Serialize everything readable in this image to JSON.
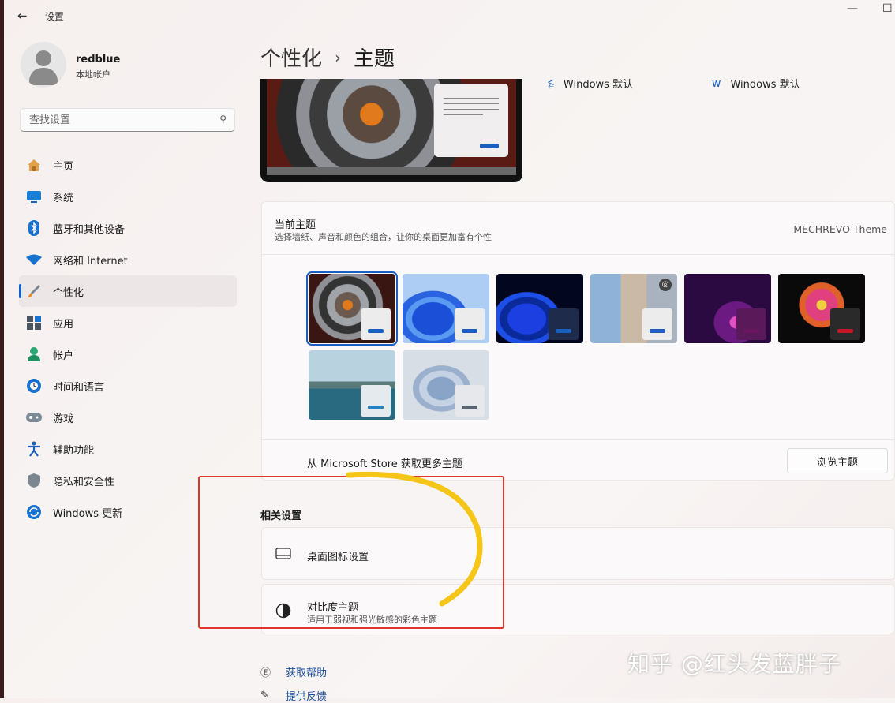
{
  "window": {
    "title": "设置",
    "minimize_glyph": "—",
    "maximize_glyph": "☐"
  },
  "user": {
    "name": "redblue",
    "account_type": "本地帐户"
  },
  "search": {
    "placeholder": "查找设置"
  },
  "nav": [
    {
      "label": "主页",
      "icon": "home-icon"
    },
    {
      "label": "系统",
      "icon": "display-icon"
    },
    {
      "label": "蓝牙和其他设备",
      "icon": "bluetooth-icon"
    },
    {
      "label": "网络和 Internet",
      "icon": "wifi-icon"
    },
    {
      "label": "个性化",
      "icon": "brush-icon",
      "selected": true
    },
    {
      "label": "应用",
      "icon": "apps-icon"
    },
    {
      "label": "帐户",
      "icon": "account-icon"
    },
    {
      "label": "时间和语言",
      "icon": "clock-globe-icon"
    },
    {
      "label": "游戏",
      "icon": "gamepad-icon"
    },
    {
      "label": "辅助功能",
      "icon": "accessibility-icon"
    },
    {
      "label": "隐私和安全性",
      "icon": "shield-icon"
    },
    {
      "label": "Windows 更新",
      "icon": "update-icon"
    }
  ],
  "breadcrumb": {
    "parent": "个性化",
    "separator": "›",
    "current": "主题"
  },
  "preview_settings": {
    "sound": "Windows 默认",
    "cursor": "Windows 默认"
  },
  "current_theme": {
    "title": "当前主题",
    "description": "选择墙纸、声音和颜色的组合，让你的桌面更加富有个性",
    "value": "MECHREVO Theme"
  },
  "themes": [
    {
      "name": "mechrevo",
      "selected": true,
      "accent": "#1a5fbf"
    },
    {
      "name": "windows-light",
      "accent": "#1a5fbf"
    },
    {
      "name": "windows-dark",
      "accent": "#1a5fbf"
    },
    {
      "name": "spotlight",
      "accent": "#1a5fbf"
    },
    {
      "name": "glow",
      "accent": "#6a1560"
    },
    {
      "name": "captured-motion",
      "accent": "#c21a24"
    },
    {
      "name": "sunrise",
      "accent": "#2a7fbf"
    },
    {
      "name": "flow",
      "accent": "#5a6470"
    }
  ],
  "store": {
    "text": "从 Microsoft Store 获取更多主题",
    "button": "浏览主题"
  },
  "related": {
    "heading": "相关设置",
    "desktop_icons": "桌面图标设置",
    "contrast_title": "对比度主题",
    "contrast_desc": "适用于弱视和强光敏感的彩色主题"
  },
  "help": {
    "get_help": "获取帮助",
    "feedback": "提供反馈"
  },
  "watermark": "知乎 @红头发蓝胖子",
  "colors": {
    "accent": "#1a5fbf",
    "annotation_red": "#e0362b",
    "annotation_yellow": "#f5c518"
  }
}
